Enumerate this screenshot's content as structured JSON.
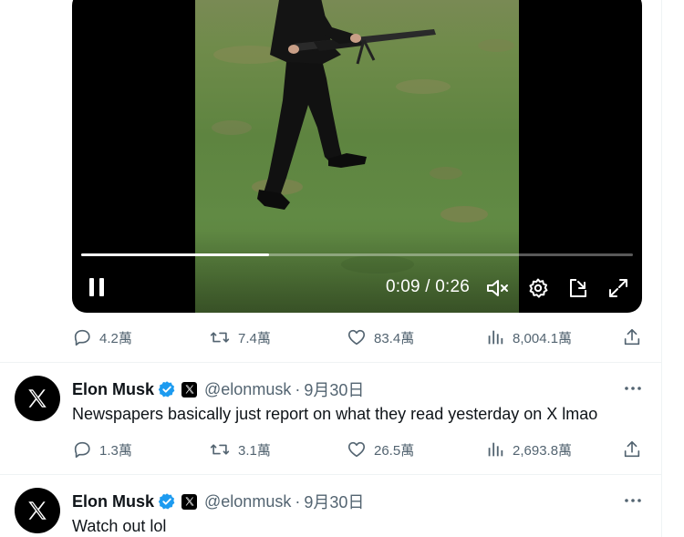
{
  "video": {
    "current_time": "0:09",
    "separator": "/",
    "duration": "0:26",
    "progress_fraction": 0.34
  },
  "post_stats_1": {
    "replies": "4.2萬",
    "reposts": "7.4萬",
    "likes": "83.4萬",
    "views": "8,004.1萬"
  },
  "tweet_2": {
    "name": "Elon Musk",
    "handle": "@elonmusk",
    "dot": "·",
    "date": "9月30日",
    "text": "Newspapers basically just report on what they read yesterday on X lmao",
    "replies": "1.3萬",
    "reposts": "3.1萬",
    "likes": "26.5萬",
    "views": "2,693.8萬"
  },
  "tweet_3": {
    "name": "Elon Musk",
    "handle": "@elonmusk",
    "dot": "·",
    "date": "9月30日",
    "text": "Watch out lol"
  },
  "colors": {
    "text_primary": "#0f1419",
    "text_secondary": "#536471",
    "verified_blue": "#1d9bf0",
    "divider": "#eff3f4",
    "video_bg": "#000000"
  },
  "icons": [
    "pause-icon",
    "volume-muted-icon",
    "gear-icon",
    "dock-icon",
    "fullscreen-icon",
    "reply-icon",
    "repost-icon",
    "like-icon",
    "views-icon",
    "share-icon",
    "x-logo-icon",
    "verified-icon",
    "more-icon"
  ]
}
